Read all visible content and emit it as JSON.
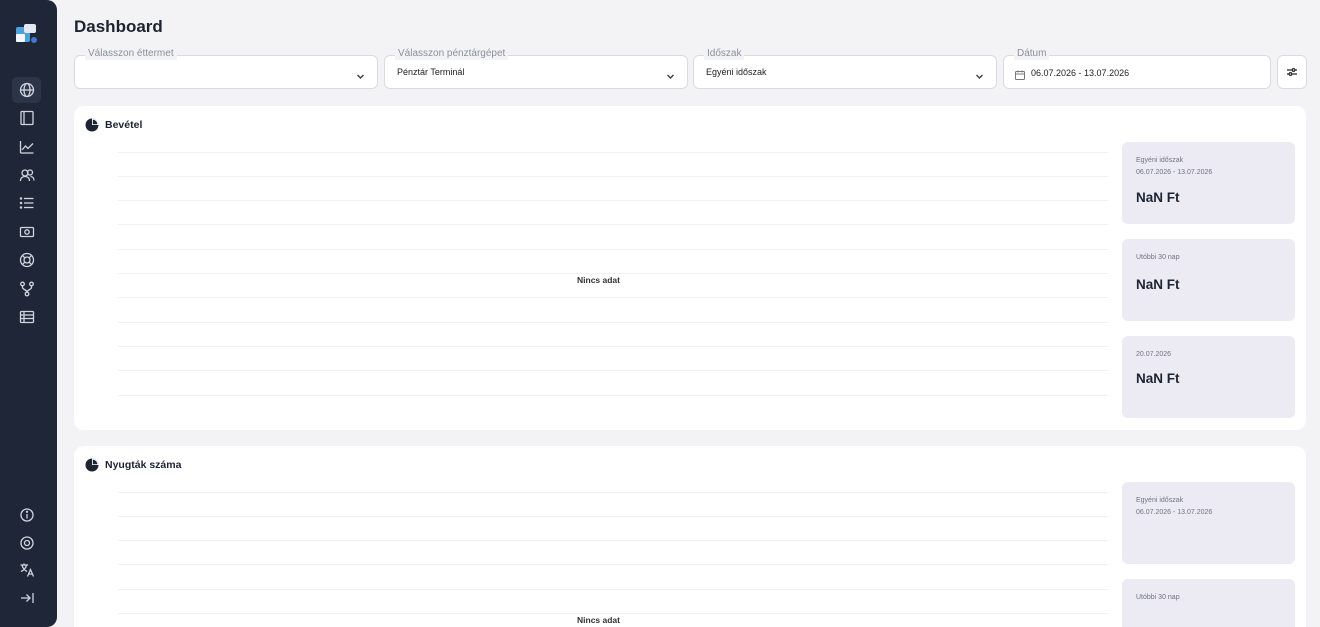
{
  "page": {
    "title": "Dashboard"
  },
  "sidebar": {
    "icons": [
      "globe-icon",
      "book-icon",
      "line-chart-icon",
      "users-icon",
      "list-icon",
      "cash-icon",
      "lifebuoy-icon",
      "fork-icon",
      "table-icon"
    ],
    "bottom_icons": [
      "info-icon",
      "settings-icon",
      "translate-icon",
      "collapse-icon"
    ]
  },
  "filters": {
    "restaurant": {
      "label": "Válasszon éttermet",
      "value": ""
    },
    "register": {
      "label": "Válasszon pénztárgépet",
      "value": "Pénztár Terminál"
    },
    "period": {
      "label": "Időszak",
      "value": "Egyéni időszak"
    },
    "date": {
      "label": "Dátum",
      "value": "06.07.2026 - 13.07.2026"
    }
  },
  "revenue": {
    "title": "Bevétel",
    "empty": "Nincs adat",
    "stats": [
      {
        "label": "Egyéni időszak",
        "sublabel": "06.07.2026 - 13.07.2026",
        "value": "NaN Ft"
      },
      {
        "label": "Utóbbi 30 nap",
        "value": "NaN Ft"
      },
      {
        "label": "20.07.2026",
        "value": "NaN Ft"
      }
    ]
  },
  "receipts": {
    "title": "Nyugták száma",
    "empty": "Nincs adat",
    "stats": [
      {
        "label": "Egyéni időszak",
        "sublabel": "06.07.2026 - 13.07.2026"
      },
      {
        "label": "Utóbbi 30 nap"
      }
    ]
  },
  "colors": {
    "sidebar": "#1f2637",
    "stat_bg": "#ecebf4",
    "page_bg": "#f3f3f5"
  }
}
